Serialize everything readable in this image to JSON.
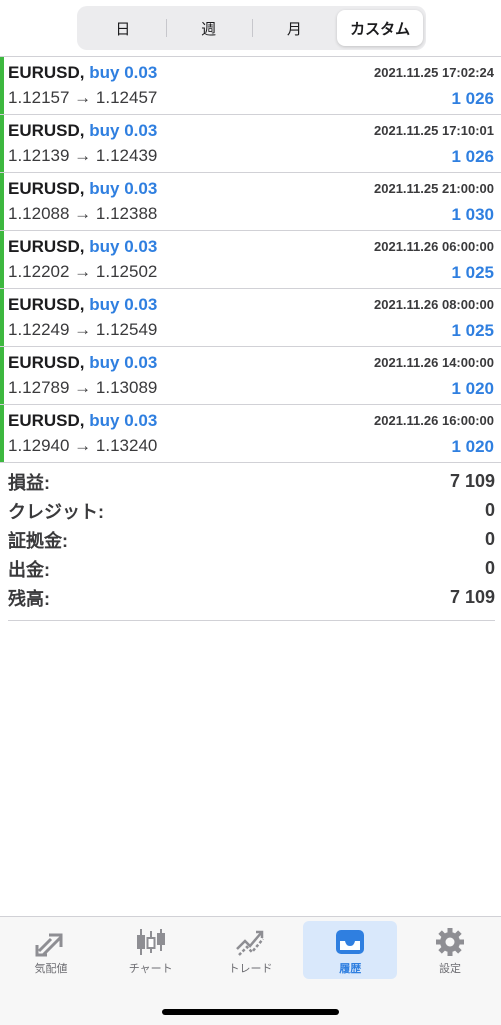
{
  "segments": [
    {
      "label": "日",
      "active": false
    },
    {
      "label": "週",
      "active": false
    },
    {
      "label": "月",
      "active": false
    },
    {
      "label": "カスタム",
      "active": true
    }
  ],
  "trades": [
    {
      "pair": "EURUSD,",
      "side": "buy 0.03",
      "time": "2021.11.25 17:02:24",
      "prices": "1.12157 → 1.12457",
      "profit": "1 026"
    },
    {
      "pair": "EURUSD,",
      "side": "buy 0.03",
      "time": "2021.11.25 17:10:01",
      "prices": "1.12139 → 1.12439",
      "profit": "1 026"
    },
    {
      "pair": "EURUSD,",
      "side": "buy 0.03",
      "time": "2021.11.25 21:00:00",
      "prices": "1.12088 → 1.12388",
      "profit": "1 030"
    },
    {
      "pair": "EURUSD,",
      "side": "buy 0.03",
      "time": "2021.11.26 06:00:00",
      "prices": "1.12202 → 1.12502",
      "profit": "1 025"
    },
    {
      "pair": "EURUSD,",
      "side": "buy 0.03",
      "time": "2021.11.26 08:00:00",
      "prices": "1.12249 → 1.12549",
      "profit": "1 025"
    },
    {
      "pair": "EURUSD,",
      "side": "buy 0.03",
      "time": "2021.11.26 14:00:00",
      "prices": "1.12789 → 1.13089",
      "profit": "1 020"
    },
    {
      "pair": "EURUSD,",
      "side": "buy 0.03",
      "time": "2021.11.26 16:00:00",
      "prices": "1.12940 → 1.13240",
      "profit": "1 020"
    }
  ],
  "summary": [
    {
      "label": "損益:",
      "value": "7 109"
    },
    {
      "label": "クレジット:",
      "value": "0"
    },
    {
      "label": "証拠金:",
      "value": "0"
    },
    {
      "label": "出金:",
      "value": "0"
    },
    {
      "label": "残高:",
      "value": "7 109"
    }
  ],
  "tabs": [
    {
      "label": "気配値",
      "icon": "quotes-icon",
      "active": false
    },
    {
      "label": "チャート",
      "icon": "chart-icon",
      "active": false
    },
    {
      "label": "トレード",
      "icon": "trade-icon",
      "active": false
    },
    {
      "label": "履歴",
      "icon": "history-icon",
      "active": true
    },
    {
      "label": "設定",
      "icon": "settings-icon",
      "active": false
    }
  ],
  "colors": {
    "accent": "#2f7fe0",
    "buy_bar": "#3db83f",
    "active_tab_bg": "#d9e8fb"
  }
}
